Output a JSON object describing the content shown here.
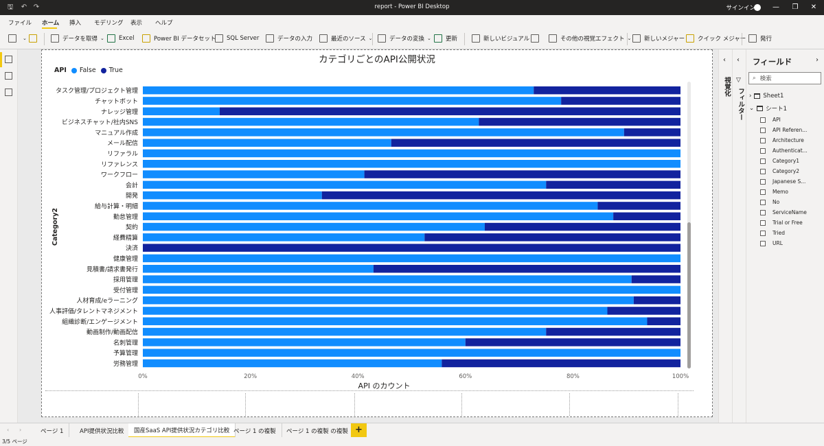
{
  "titlebar": {
    "title": "report - Power BI Desktop",
    "signin": "サインイン"
  },
  "menu": {
    "items": [
      "ファイル",
      "ホーム",
      "挿入",
      "モデリング",
      "表示",
      "ヘルプ"
    ]
  },
  "ribbon": {
    "get_data": "データを取得",
    "excel": "Excel",
    "pbi_dataset": "Power BI データセット",
    "sql_server": "SQL Server",
    "enter_data": "データの入力",
    "recent_sources": "最近のソース",
    "transform_data": "データの変換",
    "refresh": "更新",
    "new_visual": "新しいビジュアル",
    "more_visuals": "その他の視覚エフェクト",
    "new_measure": "新しいメジャー",
    "quick_measure": "クイック メジャー",
    "publish": "発行"
  },
  "panes": {
    "visualizations": "視覚化",
    "filters": "フィルター",
    "fields_title": "フィールド",
    "search_placeholder": "検索"
  },
  "fields": {
    "tables": [
      "Sheet1",
      "シート1"
    ],
    "items": [
      "API",
      "API Referen...",
      "Architecture",
      "Authenticat...",
      "Category1",
      "Category2",
      "Japanese S...",
      "Memo",
      "No",
      "ServiceName",
      "Trial or Free",
      "Tried",
      "URL"
    ]
  },
  "tabs": [
    "ページ 1",
    "API提供状況比較",
    "国産SaaS API提供状況カテゴリ比較",
    "ページ 1 の複製",
    "ページ 1 の複製 の複製"
  ],
  "status": {
    "page_indicator": "3/5 ページ"
  },
  "colors": {
    "false": "#118dff",
    "true": "#12239e",
    "accent": "#f2c811"
  },
  "chart_data": {
    "type": "bar",
    "orientation": "horizontal",
    "stacked_100": true,
    "title": "カテゴリごとのAPI公開状況",
    "legend_title": "API",
    "legend_position": "top-left",
    "xlabel": "API のカウント",
    "ylabel": "Category2",
    "x_ticks": [
      "0%",
      "20%",
      "40%",
      "60%",
      "80%",
      "100%"
    ],
    "xlim": [
      0,
      100
    ],
    "categories": [
      "タスク管理/プロジェクト管理",
      "チャットボット",
      "ナレッジ管理",
      "ビジネスチャット/社内SNS",
      "マニュアル作成",
      "メール配信",
      "リファラル",
      "リファレンス",
      "ワークフロー",
      "会計",
      "開発",
      "給与計算・明細",
      "勤怠管理",
      "契約",
      "経費精算",
      "決済",
      "健康管理",
      "見積書/請求書発行",
      "採用管理",
      "受付管理",
      "人材育成/eラーニング",
      "人事評価/タレントマネジメント",
      "組織診断/エンゲージメント",
      "動画制作/動画配信",
      "名刺管理",
      "予算管理",
      "労務管理"
    ],
    "series": [
      {
        "name": "False",
        "values": [
          72.7,
          77.8,
          14.3,
          62.5,
          89.5,
          46.2,
          100,
          100,
          41.2,
          75,
          33.3,
          84.6,
          87.5,
          63.6,
          52.4,
          0,
          100,
          42.9,
          90.9,
          100,
          91.3,
          86.4,
          93.8,
          75,
          60,
          100,
          55.6
        ]
      },
      {
        "name": "True",
        "values": [
          27.3,
          22.2,
          85.7,
          37.5,
          10.5,
          53.8,
          0,
          0,
          58.8,
          25,
          66.7,
          15.4,
          12.5,
          36.4,
          47.6,
          100,
          0,
          57.1,
          9.1,
          0,
          8.7,
          13.6,
          6.2,
          25,
          40,
          0,
          44.4
        ]
      }
    ]
  }
}
